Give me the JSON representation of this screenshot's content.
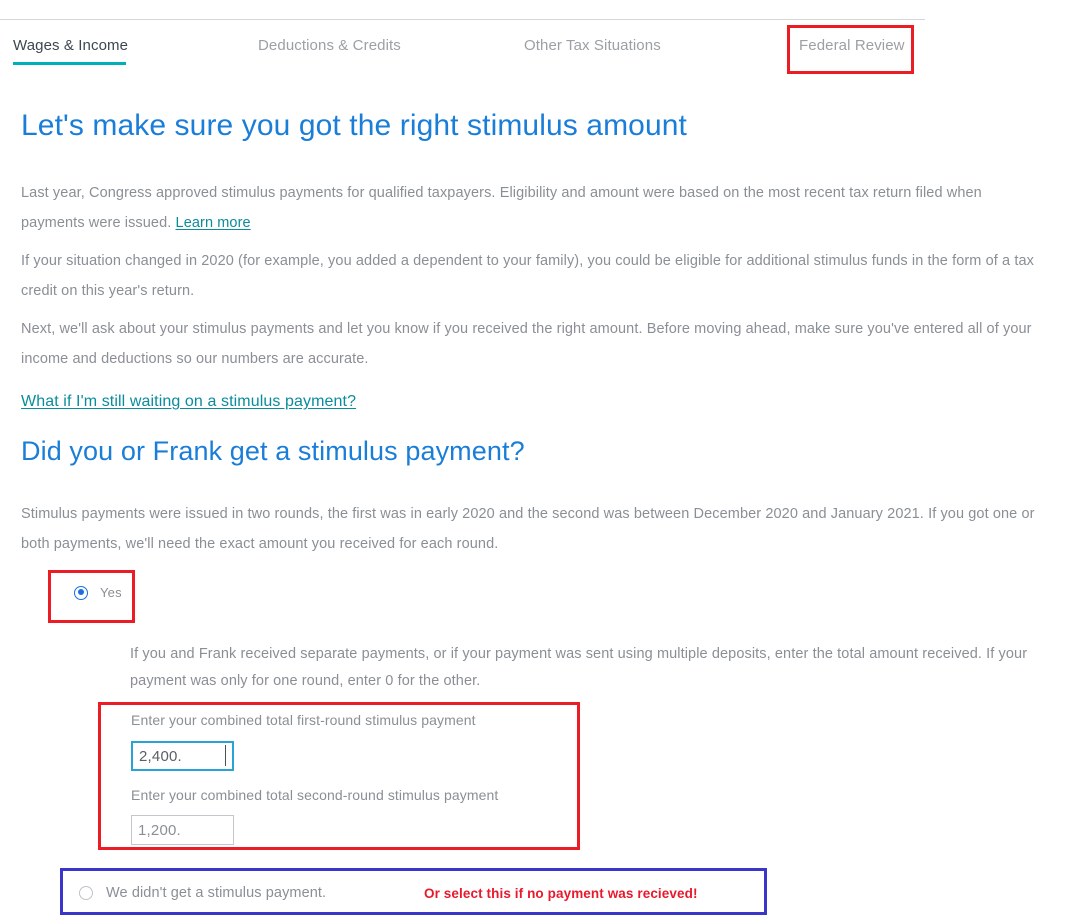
{
  "tabs": [
    {
      "label": "Wages & Income",
      "active": true
    },
    {
      "label": "Deductions & Credits",
      "active": false
    },
    {
      "label": "Other Tax Situations",
      "active": false
    },
    {
      "label": "Federal Review",
      "active": false
    }
  ],
  "page_heading": "Let's make sure you got the right stimulus amount",
  "paragraphs": {
    "p1_before_link": "Last year, Congress approved stimulus payments for qualified taxpayers. Eligibility and amount were based on the most recent tax return filed when payments were issued. ",
    "p1_link": "Learn more",
    "p2": "If your situation changed in 2020 (for example, you added a dependent to your family), you could be eligible for additional stimulus funds in the form of a tax credit on this year's return.",
    "p3": "Next, we'll ask about your stimulus payments and let you know if you received the right amount. Before moving ahead, make sure you've entered all of your income and deductions so our numbers are accurate."
  },
  "waiting_link": "What if I'm still waiting on a stimulus payment?",
  "section_heading": "Did you or Frank get a stimulus payment?",
  "section_intro": "Stimulus payments were issued in two rounds, the first was in early 2020 and the second was between December 2020 and January 2021. If you got one or both payments, we'll need the exact amount you received for each round.",
  "options": {
    "yes_label": "Yes",
    "yes_selected": true,
    "none_label": "We didn't get a stimulus payment.",
    "none_selected": false
  },
  "helper_text": "If you and Frank received separate payments, or if your payment was sent using multiple deposits, enter the total amount received. If your payment was only for one round, enter 0 for the other.",
  "fields": {
    "first_round": {
      "label": "Enter your combined total first-round stimulus payment",
      "value": "2,400.",
      "focused": true
    },
    "second_round": {
      "label": "Enter your combined total second-round stimulus payment",
      "value": "1,200.",
      "focused": false
    }
  },
  "annotations": {
    "no_payment_note": "Or select this if no payment was recieved!",
    "highlight_red": "#ec1c24",
    "highlight_blue": "#3a36c9"
  },
  "colors": {
    "heading_blue": "#1a7ed9",
    "tab_underline_teal": "#00b0b9",
    "link_teal": "#0a8c9c",
    "body_gray": "#8a8f96",
    "radio_blue": "#1a6fe0",
    "input_focus": "#29a3d6"
  }
}
